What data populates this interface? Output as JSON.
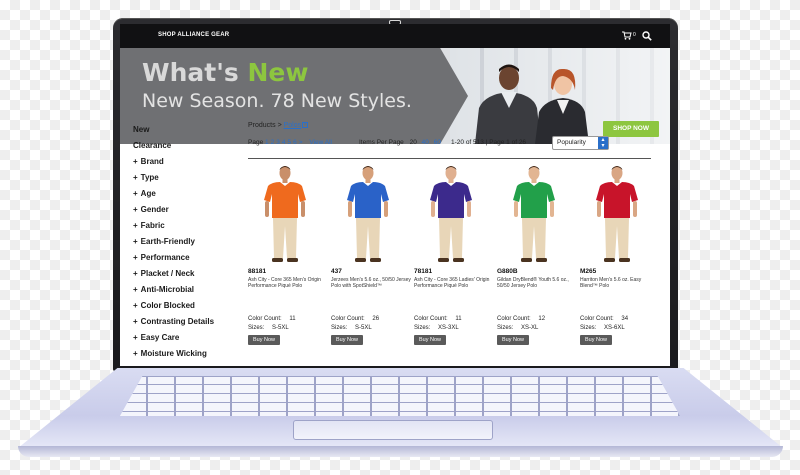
{
  "header": {
    "store_name": "SHOP ALLIANCE GEAR",
    "cart_count": "0",
    "cart_icon": "cart-icon",
    "search_icon": "search-icon"
  },
  "banner": {
    "title_prefix": "What's",
    "title_accent": "New",
    "subtitle": "New Season. 78 New Styles.",
    "button_label": "SHOP NOW",
    "accent_color": "#8dc63f"
  },
  "sidebar": {
    "links": [
      {
        "label": "New"
      },
      {
        "label": "Clearance"
      }
    ],
    "filters": [
      {
        "label": "Brand"
      },
      {
        "label": "Type"
      },
      {
        "label": "Age"
      },
      {
        "label": "Gender"
      },
      {
        "label": "Fabric"
      },
      {
        "label": "Earth-Friendly"
      },
      {
        "label": "Performance"
      },
      {
        "label": "Placket / Neck"
      },
      {
        "label": "Anti-Microbial"
      },
      {
        "label": "Color Blocked"
      },
      {
        "label": "Contrasting Details"
      },
      {
        "label": "Easy Care"
      },
      {
        "label": "Moisture Wicking"
      }
    ]
  },
  "breadcrumb": {
    "root": "Products >",
    "current": "Polos"
  },
  "pagination": {
    "label": "Page",
    "pages": [
      "1",
      "2",
      "3",
      "4",
      "5",
      "6",
      ">"
    ],
    "view_all": "View All"
  },
  "per_page": {
    "label": "Items Per Page",
    "options": [
      "20",
      "40",
      "60"
    ]
  },
  "results": "1-20 of 513 | Page 1 of 26",
  "sort": {
    "selected": "Popularity"
  },
  "product_labels": {
    "color_count": "Color Count:",
    "sizes": "Sizes:",
    "buy_now": "Buy Now"
  },
  "products": [
    {
      "sku": "88181",
      "description": "Ash City - Core 365 Men's Origin Performance Piqué Polo",
      "color_count": "11",
      "sizes": "S-5XL",
      "shirt_color": "#ef6a1e",
      "skin": "#c98f6a"
    },
    {
      "sku": "437",
      "description": "Jerzees Men's 5.6 oz., 50/50 Jersey Polo with SpotShield™",
      "color_count": "26",
      "sizes": "S-5XL",
      "shirt_color": "#2a62c8",
      "skin": "#d6a07a"
    },
    {
      "sku": "78181",
      "description": "Ash City - Core 365 Ladies' Origin Performance Piqué Polo",
      "color_count": "11",
      "sizes": "XS-3XL",
      "shirt_color": "#3c2a8c",
      "skin": "#e0b090"
    },
    {
      "sku": "G880B",
      "description": "Gildan DryBlend® Youth 5.6 oz., 50/50 Jersey Polo",
      "color_count": "12",
      "sizes": "XS-XL",
      "shirt_color": "#22a04a",
      "skin": "#e2b592"
    },
    {
      "sku": "M265",
      "description": "Harriton Men's 5.6 oz. Easy Blend™ Polo",
      "color_count": "34",
      "sizes": "XS-6XL",
      "shirt_color": "#c8142a",
      "skin": "#d9a684"
    }
  ]
}
